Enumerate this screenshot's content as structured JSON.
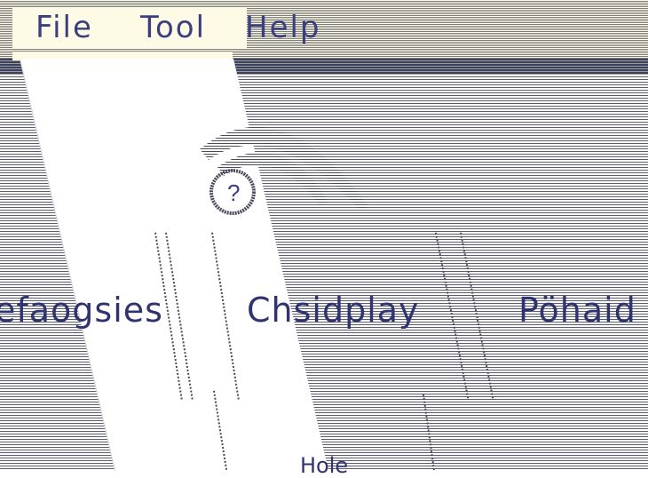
{
  "menubar": {
    "items": [
      {
        "label": "File",
        "mnemonic": "i"
      },
      {
        "label": "Tool",
        "mnemonic": "T"
      },
      {
        "label": "Help"
      }
    ]
  },
  "items": [
    {
      "label": "efaogsies"
    },
    {
      "label": "Chsidplay"
    },
    {
      "label": "Pöhaid"
    }
  ],
  "bottom": {
    "label": "Hole"
  },
  "colors": {
    "menu_bg": "#fdfbe6",
    "text": "#3b3f80",
    "separator": "#3d4160"
  }
}
